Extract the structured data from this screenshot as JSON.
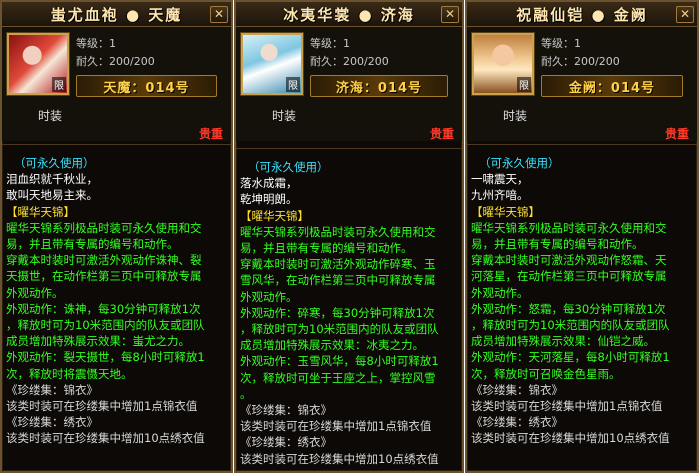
{
  "items": [
    {
      "title": "蚩尤血袍 ● 天魔",
      "level": "等级：1",
      "durability": "耐久：200/200",
      "nameplate": "天魔：014号",
      "portrait_tag": "限",
      "slot": "时装",
      "rarity": "贵重",
      "usage": "（可永久使用）",
      "poem": [
        "泪血织就千秋业，",
        "敢叫天地易主来。"
      ],
      "set_name": "【曜华天锦】",
      "desc": [
        "曜华天锦系列极品时装可永久使用和交",
        "易，并且带有专属的编号和动作。",
        "穿戴本时装时可激活外观动作诛神、裂",
        "天摄世，在动作栏第三页中可释放专属",
        "外观动作。",
        "外观动作：诛神，每30分钟可释放1次",
        "，释放时可为10米范围内的队友或团队",
        "成员增加特殊展示效果：蚩尤之力。",
        "外观动作：裂天摄世，每8小时可释放1",
        "次，释放时将震慑天地。"
      ],
      "collections": [
        "《珍缕集：锦衣》",
        "该类时装可在珍缕集中增加1点锦衣值",
        "《珍缕集：绣衣》",
        "该类时装可在珍缕集中增加10点绣衣值"
      ]
    },
    {
      "title": "冰夷华裳 ● 济海",
      "level": "等级：1",
      "durability": "耐久：200/200",
      "nameplate": "济海：014号",
      "portrait_tag": "限",
      "slot": "时装",
      "rarity": "贵重",
      "usage": "（可永久使用）",
      "poem": [
        "落水成霜，",
        "乾坤明朗。"
      ],
      "set_name": "【曜华天锦】",
      "desc": [
        "曜华天锦系列极品时装可永久使用和交",
        "易，并且带有专属的编号和动作。",
        "穿戴本时装时可激活外观动作碎寒、玉",
        "雪风华，在动作栏第三页中可释放专属",
        "外观动作。",
        "外观动作：碎寒，每30分钟可释放1次",
        "，释放时可为10米范围内的队友或团队",
        "成员增加特殊展示效果：冰夷之力。",
        "外观动作：玉雪风华，每8小时可释放1",
        "次，释放时可坐于王座之上，掌控风雪",
        "。"
      ],
      "collections": [
        "《珍缕集：锦衣》",
        "该类时装可在珍缕集中增加1点锦衣值",
        "《珍缕集：绣衣》",
        "该类时装可在珍缕集中增加10点绣衣值"
      ]
    },
    {
      "title": "祝融仙铠 ● 金阙",
      "level": "等级：1",
      "durability": "耐久：200/200",
      "nameplate": "金阙：014号",
      "portrait_tag": "限",
      "slot": "时装",
      "rarity": "贵重",
      "usage": "（可永久使用）",
      "poem": [
        "一啸震天，",
        "九州齐喑。"
      ],
      "set_name": "【曜华天锦】",
      "desc": [
        "曜华天锦系列极品时装可永久使用和交",
        "易，并且带有专属的编号和动作。",
        "穿戴本时装时可激活外观动作怒霜、天",
        "河落星，在动作栏第三页中可释放专属",
        "外观动作。",
        "外观动作：怒霜，每30分钟可释放1次",
        "，释放时可为10米范围内的队友或团队",
        "成员增加特殊展示效果：仙铠之威。",
        "外观动作：天河落星，每8小时可释放1",
        "次，释放时可召唤金色星雨。"
      ],
      "collections": [
        "《珍缕集：锦衣》",
        "该类时装可在珍缕集中增加1点锦衣值",
        "《珍缕集：绣衣》",
        "该类时装可在珍缕集中增加10点绣衣值"
      ]
    }
  ],
  "close_glyph": "✕",
  "colors": {
    "usage": "#34e3ff",
    "set_name": "#ffe033",
    "desc": "#33ff22",
    "rarity": "#ff3a2a",
    "nameplate": "#ffd24a"
  }
}
